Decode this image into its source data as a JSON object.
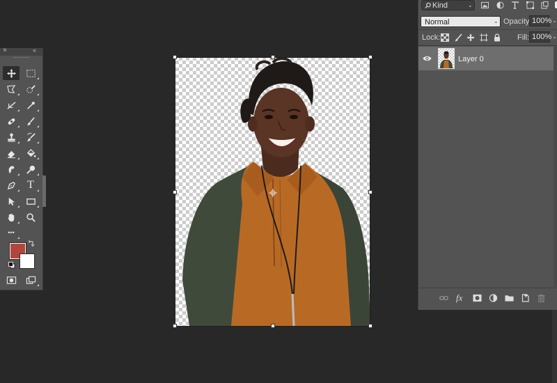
{
  "layers_panel": {
    "filter_label": "Kind",
    "blend_mode": "Normal",
    "opacity_label": "Opacity:",
    "opacity_value": "100%",
    "lock_label": "Lock:",
    "fill_label": "Fill:",
    "fill_value": "100%",
    "layers": [
      {
        "name": "Layer 0",
        "visible": true,
        "selected": true
      }
    ],
    "filter_icons": [
      "image-filter-icon",
      "adjustment-filter-icon",
      "type-filter-icon",
      "shape-filter-icon",
      "smart-object-filter-icon"
    ],
    "lock_icons": [
      "lock-transparent-icon",
      "lock-image-icon",
      "lock-position-icon",
      "lock-artboard-icon",
      "lock-all-icon"
    ],
    "bottom_icons": [
      "link-layers-icon",
      "fx-icon",
      "add-mask-icon",
      "adjustment-layer-icon",
      "new-group-icon",
      "new-layer-icon",
      "delete-layer-icon"
    ]
  },
  "tools_panel": {
    "close_glyph": "×",
    "collapse_glyph": "‹‹",
    "more_tools_glyph": "•••",
    "type_tool_glyph": "T",
    "tools": [
      "move-tool",
      "marquee-tool",
      "lasso-tool",
      "quick-selection-tool",
      "crop-tool",
      "eyedropper-tool",
      "healing-brush-tool",
      "brush-tool",
      "clone-stamp-tool",
      "history-brush-tool",
      "eraser-tool",
      "paint-bucket-tool",
      "smudge-tool",
      "dodge-tool",
      "pen-tool",
      "type-tool",
      "path-selection-tool",
      "rectangle-tool",
      "hand-tool",
      "zoom-tool",
      "edit-toolbar",
      "quick-mask",
      "screen-mode"
    ],
    "foreground_color": "#b2453c",
    "background_color": "#ffffff"
  },
  "document": {
    "transparent_background": true,
    "subject_colors": {
      "blouse": "#b86a24",
      "cardigan": "#3f4a3b",
      "skin": "#5a3424",
      "hair": "#1f1a18"
    }
  }
}
